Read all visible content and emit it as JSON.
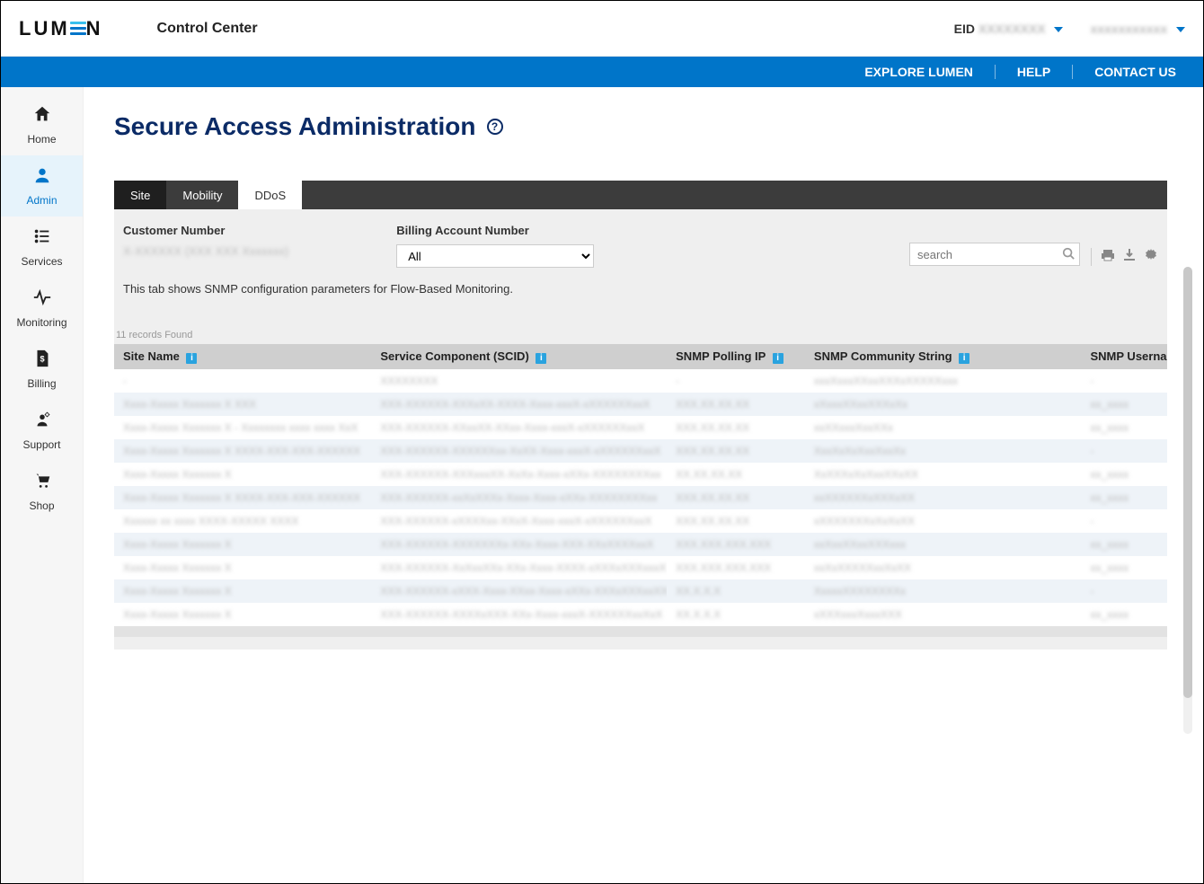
{
  "header": {
    "brand": "LUMEN",
    "product": "Control Center",
    "eid_label": "EID",
    "eid_value": "XXXXXXXX",
    "username": "xxxxxxxxxxx"
  },
  "bluebar": {
    "explore": "EXPLORE LUMEN",
    "help": "HELP",
    "contact": "CONTACT US"
  },
  "sidebar": {
    "items": [
      {
        "label": "Home",
        "icon": "home",
        "active": false
      },
      {
        "label": "Admin",
        "icon": "user",
        "active": true
      },
      {
        "label": "Services",
        "icon": "list",
        "active": false
      },
      {
        "label": "Monitoring",
        "icon": "pulse",
        "active": false
      },
      {
        "label": "Billing",
        "icon": "bill",
        "active": false
      },
      {
        "label": "Support",
        "icon": "gear-user",
        "active": false
      },
      {
        "label": "Shop",
        "icon": "cart",
        "active": false
      }
    ]
  },
  "page": {
    "title": "Secure Access Administration",
    "help_glyph": "?"
  },
  "tabs": [
    {
      "label": "Site",
      "state": "dark"
    },
    {
      "label": "Mobility",
      "state": "normal"
    },
    {
      "label": "DDoS",
      "state": "active"
    }
  ],
  "filters": {
    "customer_label": "Customer Number",
    "customer_value": "X-XXXXXX (XXX XXX Xxxxxxx)",
    "billing_label": "Billing Account Number",
    "billing_value": "All",
    "search_placeholder": "search"
  },
  "description": "This tab shows SNMP configuration parameters for Flow-Based Monitoring.",
  "records_found": "11 records Found",
  "table": {
    "columns": [
      "Site Name",
      "Service Component (SCID)",
      "SNMP Polling IP",
      "SNMP Community String",
      "SNMP Userna"
    ],
    "info_columns": [
      true,
      true,
      true,
      true,
      false
    ],
    "rows": [
      {
        "site": "-",
        "scid": "XXXXXXXX",
        "ip": "-",
        "community": "xxxXxxxXXxxXXXxXXXXXxxx",
        "user": "-"
      },
      {
        "site": "Xxxx-Xxxxx Xxxxxxx X XXX",
        "scid": "XXX-XXXXXX-XXXxXX-XXXX-Xxxx-xxxX-xXXXXXXxxX",
        "ip": "XXX.XX.XX.XX",
        "community": "xXxxxXXxxXXXxXx",
        "user": "xx_xxxx"
      },
      {
        "site": "Xxxx-Xxxxx Xxxxxxx X - Xxxxxxxx xxxx xxxx XxX",
        "scid": "XXX-XXXXXX-XXxxXX-XXxx-Xxxx-xxxX-xXXXXXXxxX",
        "ip": "XXX.XX.XX.XX",
        "community": "xxXXxxxXxxXXx",
        "user": "xx_xxxx"
      },
      {
        "site": "Xxxx-Xxxxx Xxxxxxx X XXXX-XXX-XXX-XXXXXX",
        "scid": "XXX-XXXXXX-XXXXXXxx-XxXX-Xxxx-xxxX-xXXXXXXxxX",
        "ip": "XXX.XX.XX.XX",
        "community": "XxxXxXxXxxXxxXx",
        "user": "-"
      },
      {
        "site": "Xxxx-Xxxxx Xxxxxxx X",
        "scid": "XXX-XXXXXX-XXXxxxXX-XxXx-Xxxx-xXXx-XXXXXXXXxx",
        "ip": "XX.XX.XX.XX",
        "community": "XxXXXxXxXxxXXxXX",
        "user": "xx_xxxx"
      },
      {
        "site": "Xxxx-Xxxxx Xxxxxxx X XXXX-XXX-XXX-XXXXXX",
        "scid": "XXX-XXXXXX-xxXxXXXx-Xxxx-Xxxx-xXXx-XXXXXXXXxx",
        "ip": "XXX.XX.XX.XX",
        "community": "xxXXXXXXxXXXxXX",
        "user": "xx_xxxx"
      },
      {
        "site": "Xxxxxx xx xxxx XXXX-XXXXX XXXX",
        "scid": "XXX-XXXXXX-xXXXXxx-XXxX-Xxxx-xxxX-xXXXXXXxxX",
        "ip": "XXX.XX.XX.XX",
        "community": "xXXXXXXXxXxXxXX",
        "user": "-"
      },
      {
        "site": "Xxxx-Xxxxx Xxxxxxx X",
        "scid": "XXX-XXXXXX-XXXXXXXx-XXx-Xxxx-XXX-XXxXXXXxxX",
        "ip": "XXX.XXX.XXX.XXX",
        "community": "xxXxxXXxxXXXxxx",
        "user": "xx_xxxx"
      },
      {
        "site": "Xxxx-Xxxxx Xxxxxxx X",
        "scid": "XXX-XXXXXX-XxXxxXXx-XXx-Xxxx-XXXX-xXXXxXXXxxxX",
        "ip": "XXX.XXX.XXX.XXX",
        "community": "xxXxXXXXXxxXxXX",
        "user": "xx_xxxx"
      },
      {
        "site": "Xxxx-Xxxxx Xxxxxxx X",
        "scid": "XXX-XXXXXX-xXXX-Xxxx-XXxx-Xxxx-xXXx-XXXxXXXxxXX",
        "ip": "XX.X.X.X",
        "community": "XxxxxXXXXXXXXx",
        "user": "-"
      },
      {
        "site": "Xxxx-Xxxxx Xxxxxxx X",
        "scid": "XXX-XXXXXX-XXXXxXXX-XXx-Xxxx-xxxX-XXXXXXxxXxX",
        "ip": "XX.X.X.X",
        "community": "xXXXxxxXxxxXXX",
        "user": "xx_xxxx"
      }
    ]
  }
}
